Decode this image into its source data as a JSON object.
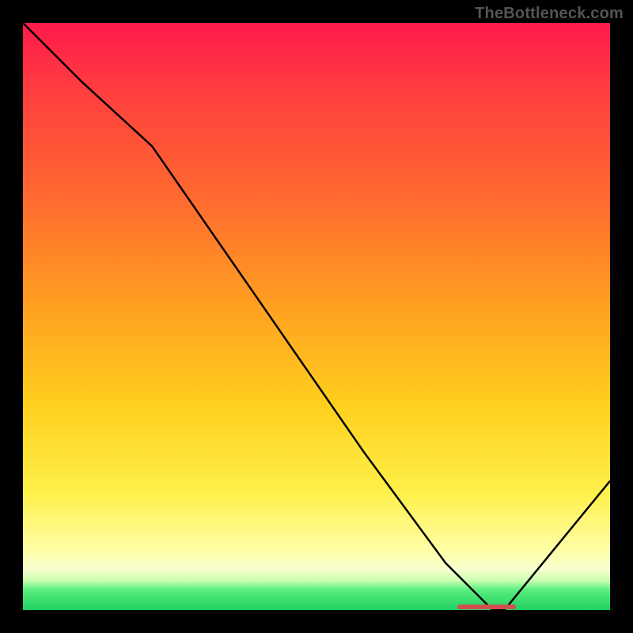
{
  "watermark": "TheBottleneck.com",
  "chart_data": {
    "type": "line",
    "title": "",
    "xlabel": "",
    "ylabel": "",
    "xlim": [
      0,
      100
    ],
    "ylim": [
      0,
      100
    ],
    "grid": false,
    "legend": false,
    "series": [
      {
        "name": "bottleneck-curve",
        "x": [
          0,
          10,
          22,
          40,
          58,
          72,
          80,
          82,
          100
        ],
        "y": [
          100,
          90,
          79,
          53,
          27,
          8,
          0,
          0,
          22
        ]
      }
    ],
    "annotations": [
      {
        "name": "optimum-marker",
        "x_start": 74,
        "x_end": 84,
        "y": 0.5
      }
    ],
    "gradient_stops": [
      {
        "pct": 0,
        "color": "#ff1a4a"
      },
      {
        "pct": 12,
        "color": "#ff3f3f"
      },
      {
        "pct": 30,
        "color": "#ff6a2f"
      },
      {
        "pct": 48,
        "color": "#ff9f20"
      },
      {
        "pct": 65,
        "color": "#ffcf1e"
      },
      {
        "pct": 80,
        "color": "#fff04a"
      },
      {
        "pct": 90,
        "color": "#ffffa8"
      },
      {
        "pct": 93,
        "color": "#f8ffd0"
      },
      {
        "pct": 95,
        "color": "#c8ffb0"
      },
      {
        "pct": 96.5,
        "color": "#5bee80"
      },
      {
        "pct": 100,
        "color": "#1ed060"
      }
    ]
  }
}
